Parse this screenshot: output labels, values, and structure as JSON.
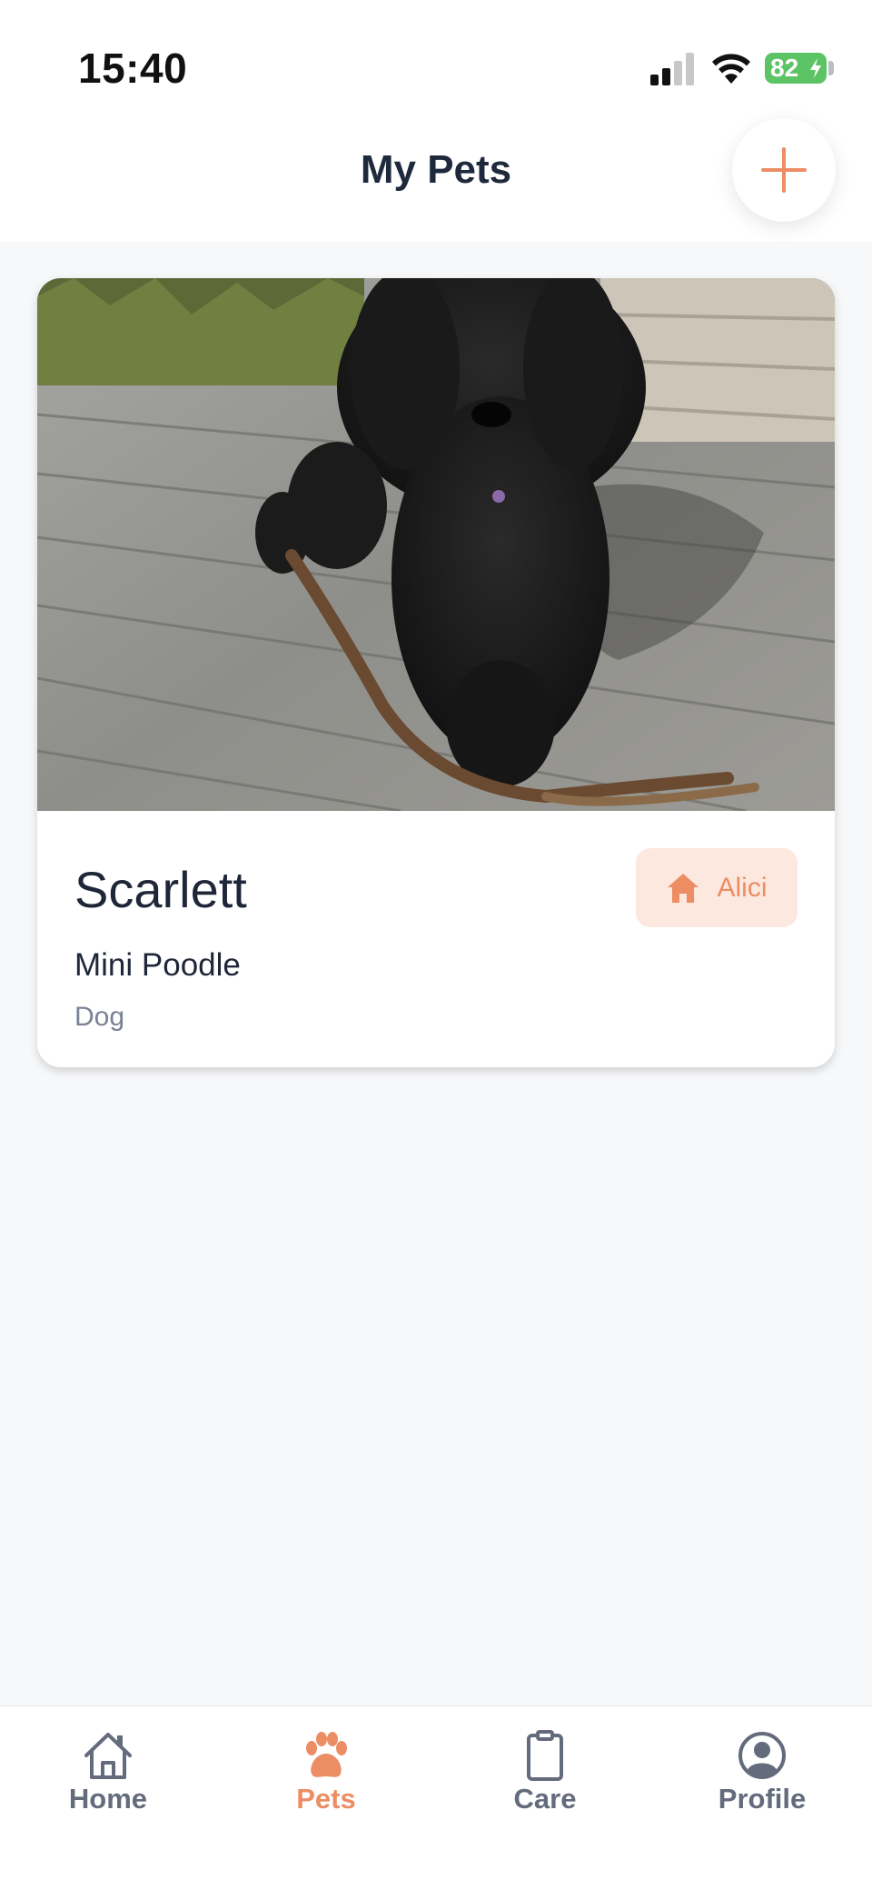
{
  "status_bar": {
    "time": "15:40",
    "battery_level": "82",
    "icons": [
      "signal-icon",
      "wifi-icon",
      "battery-icon"
    ]
  },
  "header": {
    "title": "My Pets",
    "add_icon": "plus-icon"
  },
  "pets": [
    {
      "name": "Scarlett",
      "breed": "Mini Poodle",
      "species": "Dog",
      "owner_badge": "Alici",
      "owner_icon": "home-icon",
      "photo": "black curly poodle standing on wooden deck with a stick"
    }
  ],
  "bottom_nav": {
    "items": [
      {
        "label": "Home",
        "icon": "home-outline-icon",
        "active": false
      },
      {
        "label": "Pets",
        "icon": "paw-icon",
        "active": true
      },
      {
        "label": "Care",
        "icon": "clipboard-icon",
        "active": false
      },
      {
        "label": "Profile",
        "icon": "user-circle-icon",
        "active": false
      }
    ]
  },
  "colors": {
    "accent": "#ec8d64",
    "badge_background": "#fde8df",
    "text_primary": "#1e2638",
    "text_secondary": "#7a8194",
    "nav_inactive": "#636b7d",
    "battery": "#5dc466",
    "background": "#f7f8fa"
  }
}
